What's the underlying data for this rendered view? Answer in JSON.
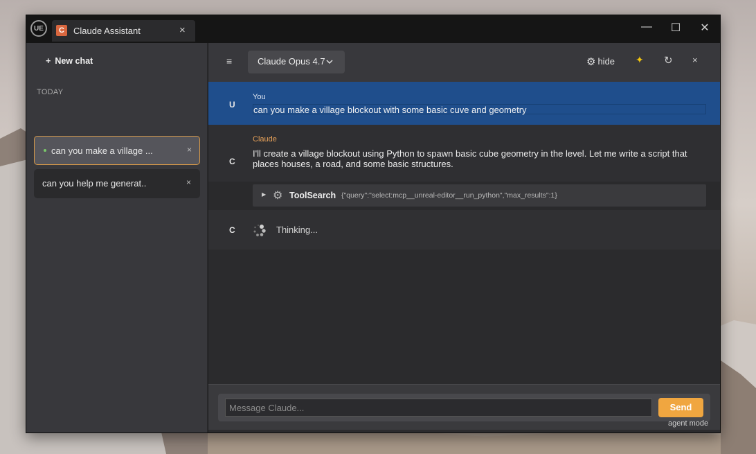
{
  "window": {
    "app_logo": "UE",
    "tab": {
      "icon_letter": "C",
      "title": "Claude Assistant",
      "close": "×"
    },
    "controls": {
      "minimize": "—",
      "maximize": "☐",
      "close": "✕"
    }
  },
  "sidebar": {
    "new_chat_label": "New chat",
    "section_label": "TODAY",
    "chats": [
      {
        "label": "can you make a village ...",
        "active": true,
        "close": "×"
      },
      {
        "label": "can you help me generat...",
        "active": false,
        "close": "×"
      }
    ]
  },
  "topbar": {
    "menu_icon": "≡",
    "model": "Claude Opus 4.7",
    "hide_label": "hide",
    "sparkle": "✦",
    "refresh": "↻",
    "close": "×"
  },
  "messages": [
    {
      "avatar": "U",
      "sender": "You",
      "text": "can you make a village blockout with some basic cuve and geometry"
    },
    {
      "avatar": "C",
      "sender": "Claude",
      "text": "I'll create a village blockout using Python to spawn basic cube geometry in the level. Let me write a script that places houses, a road, and some basic structures."
    }
  ],
  "tool_call": {
    "name": "ToolSearch",
    "args": "{\"query\":\"select:mcp__unreal-editor__run_python\",\"max_results\":1}"
  },
  "thinking": {
    "avatar": "C",
    "text": "Thinking..."
  },
  "composer": {
    "placeholder": "Message Claude...",
    "send_label": "Send"
  },
  "footer": {
    "mode": "agent mode"
  },
  "colors": {
    "accent": "#f0a640",
    "user_bubble": "#1f4e8c",
    "claude_name": "#e8a25a"
  }
}
